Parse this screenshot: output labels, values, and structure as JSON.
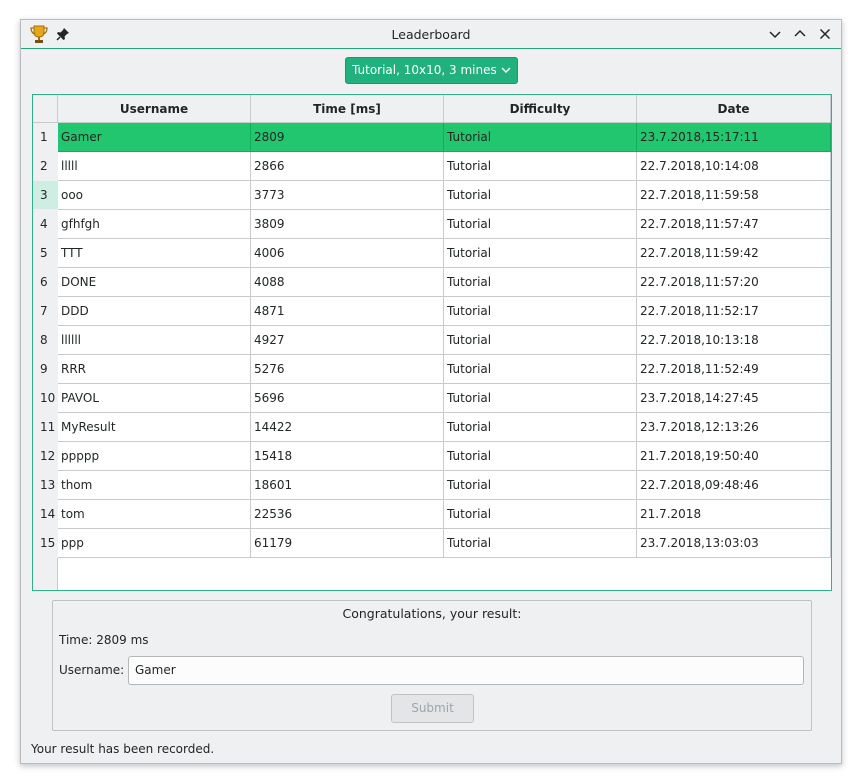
{
  "window": {
    "title": "Leaderboard"
  },
  "filter": {
    "selected": "Tutorial, 10x10, 3 mines"
  },
  "table": {
    "columns": [
      "Username",
      "Time [ms]",
      "Difficulty",
      "Date"
    ],
    "rows": [
      [
        "1",
        "Gamer",
        "2809",
        "Tutorial",
        "23.7.2018,15:17:11"
      ],
      [
        "2",
        "lllll",
        "2866",
        "Tutorial",
        "22.7.2018,10:14:08"
      ],
      [
        "3",
        "ooo",
        "3773",
        "Tutorial",
        "22.7.2018,11:59:58"
      ],
      [
        "4",
        "gfhfgh",
        "3809",
        "Tutorial",
        "22.7.2018,11:57:47"
      ],
      [
        "5",
        "TTT",
        "4006",
        "Tutorial",
        "22.7.2018,11:59:42"
      ],
      [
        "6",
        "DONE",
        "4088",
        "Tutorial",
        "22.7.2018,11:57:20"
      ],
      [
        "7",
        "DDD",
        "4871",
        "Tutorial",
        "22.7.2018,11:52:17"
      ],
      [
        "8",
        "llllll",
        "4927",
        "Tutorial",
        "22.7.2018,10:13:18"
      ],
      [
        "9",
        "RRR",
        "5276",
        "Tutorial",
        "22.7.2018,11:52:49"
      ],
      [
        "10",
        "PAVOL",
        "5696",
        "Tutorial",
        "23.7.2018,14:27:45"
      ],
      [
        "11",
        "MyResult",
        "14422",
        "Tutorial",
        "23.7.2018,12:13:26"
      ],
      [
        "12",
        "ppppp",
        "15418",
        "Tutorial",
        "21.7.2018,19:50:40"
      ],
      [
        "13",
        "thom",
        "18601",
        "Tutorial",
        "22.7.2018,09:48:46"
      ],
      [
        "14",
        "tom",
        "22536",
        "Tutorial",
        "21.7.2018"
      ],
      [
        "15",
        "ppp",
        "61179",
        "Tutorial",
        "23.7.2018,13:03:03"
      ]
    ]
  },
  "result": {
    "title": "Congratulations, your result:",
    "time_label": "Time:  2809 ms",
    "username_label": "Username:",
    "username_value": "Gamer",
    "submit_label": "Submit"
  },
  "status": "Your result has been recorded.",
  "colors": {
    "accent": "#22b07f",
    "selection": "#22c66f",
    "frame": "#2fb28b"
  },
  "icons": {
    "app": "trophy-icon",
    "pin": "pin-icon",
    "minimize": "chevron-down-icon",
    "maximize": "chevron-up-icon",
    "close": "close-icon"
  }
}
